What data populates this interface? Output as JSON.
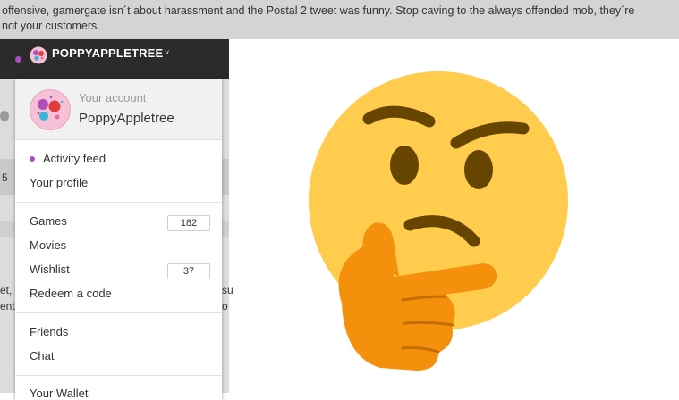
{
  "page_text": {
    "line1": "offensive, gamergate isn´t about harassment and the Postal 2 tweet was funny. Stop caving to the always offended mob, they´re",
    "line2": "not your customers."
  },
  "userbar": {
    "username": "POPPYAPPLETREE",
    "caret": "˅"
  },
  "under": {
    "frag1": "5",
    "frag2": "et,",
    "frag3": "ent",
    "frag4": "su",
    "frag5": "o"
  },
  "menu": {
    "account_label": "Your account",
    "account_name": "PoppyAppletree",
    "activity_feed": "Activity feed",
    "your_profile": "Your profile",
    "games": "Games",
    "games_count": "182",
    "movies": "Movies",
    "wishlist": "Wishlist",
    "wishlist_count": "37",
    "redeem": "Redeem a code",
    "friends": "Friends",
    "chat": "Chat",
    "wallet": "Your Wallet"
  },
  "colors": {
    "accent_dot": "#a64fbf",
    "userbar_bg": "#2b2b2b",
    "emoji_face": "#ffcc4d",
    "emoji_hand": "#f4900c"
  },
  "icons": {
    "emoji": "thinking-face-emoji",
    "avatar": "flower-avatar"
  }
}
